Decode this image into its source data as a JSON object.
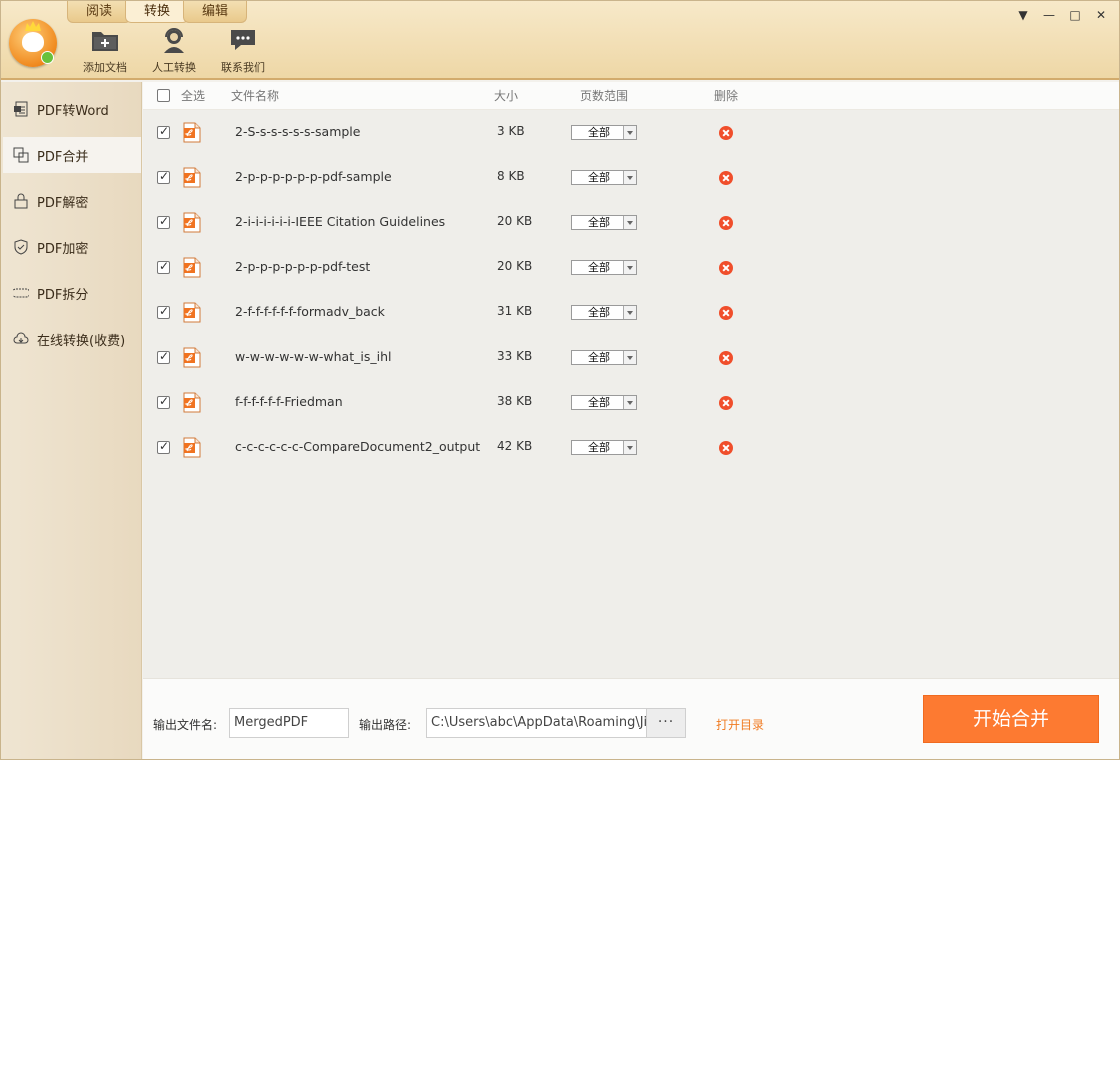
{
  "tabs": [
    {
      "label": "阅读",
      "active": false
    },
    {
      "label": "转换",
      "active": true
    },
    {
      "label": "编辑",
      "active": false
    }
  ],
  "toolbar": {
    "add_doc": "添加文档",
    "manual_convert": "人工转换",
    "contact_us": "联系我们"
  },
  "window_controls": {
    "menu": "▼",
    "minimize": "—",
    "maximize": "□",
    "close": "✕"
  },
  "sidebar": {
    "items": [
      {
        "label": "PDF转Word",
        "icon": "word-doc-icon",
        "active": false
      },
      {
        "label": "PDF合并",
        "icon": "merge-icon",
        "active": true
      },
      {
        "label": "PDF解密",
        "icon": "unlock-icon",
        "active": false
      },
      {
        "label": "PDF加密",
        "icon": "shield-icon",
        "active": false
      },
      {
        "label": "PDF拆分",
        "icon": "split-icon",
        "active": false
      },
      {
        "label": "在线转换(收费)",
        "icon": "cloud-icon",
        "active": false
      }
    ]
  },
  "table": {
    "headers": {
      "select_all": "全选",
      "name": "文件名称",
      "size": "大小",
      "range": "页数范围",
      "delete": "删除"
    },
    "rows": [
      {
        "name": "2-S-s-s-s-s-s-sample",
        "size": "3 KB",
        "range": "全部",
        "checked": true
      },
      {
        "name": "2-p-p-p-p-p-p-pdf-sample",
        "size": "8 KB",
        "range": "全部",
        "checked": true
      },
      {
        "name": "2-i-i-i-i-i-i-IEEE Citation Guidelines",
        "size": "20 KB",
        "range": "全部",
        "checked": true
      },
      {
        "name": "2-p-p-p-p-p-p-pdf-test",
        "size": "20 KB",
        "range": "全部",
        "checked": true
      },
      {
        "name": "2-f-f-f-f-f-f-formadv_back",
        "size": "31 KB",
        "range": "全部",
        "checked": true
      },
      {
        "name": "w-w-w-w-w-w-what_is_ihl",
        "size": "33 KB",
        "range": "全部",
        "checked": true
      },
      {
        "name": "f-f-f-f-f-f-Friedman",
        "size": "38 KB",
        "range": "全部",
        "checked": true
      },
      {
        "name": "c-c-c-c-c-c-CompareDocument2_output",
        "size": "42 KB",
        "range": "全部",
        "checked": true
      }
    ]
  },
  "bottom": {
    "output_name_label": "输出文件名:",
    "output_name_value": "MergedPDF",
    "output_path_label": "输出路径:",
    "output_path_value": "C:\\Users\\abc\\AppData\\Roaming\\Jis",
    "browse_label": "···",
    "open_dir": "打开目录",
    "start_button": "开始合并"
  },
  "colors": {
    "accent": "#fd7a31",
    "delete": "#f04e2b",
    "link": "#f07b21"
  }
}
